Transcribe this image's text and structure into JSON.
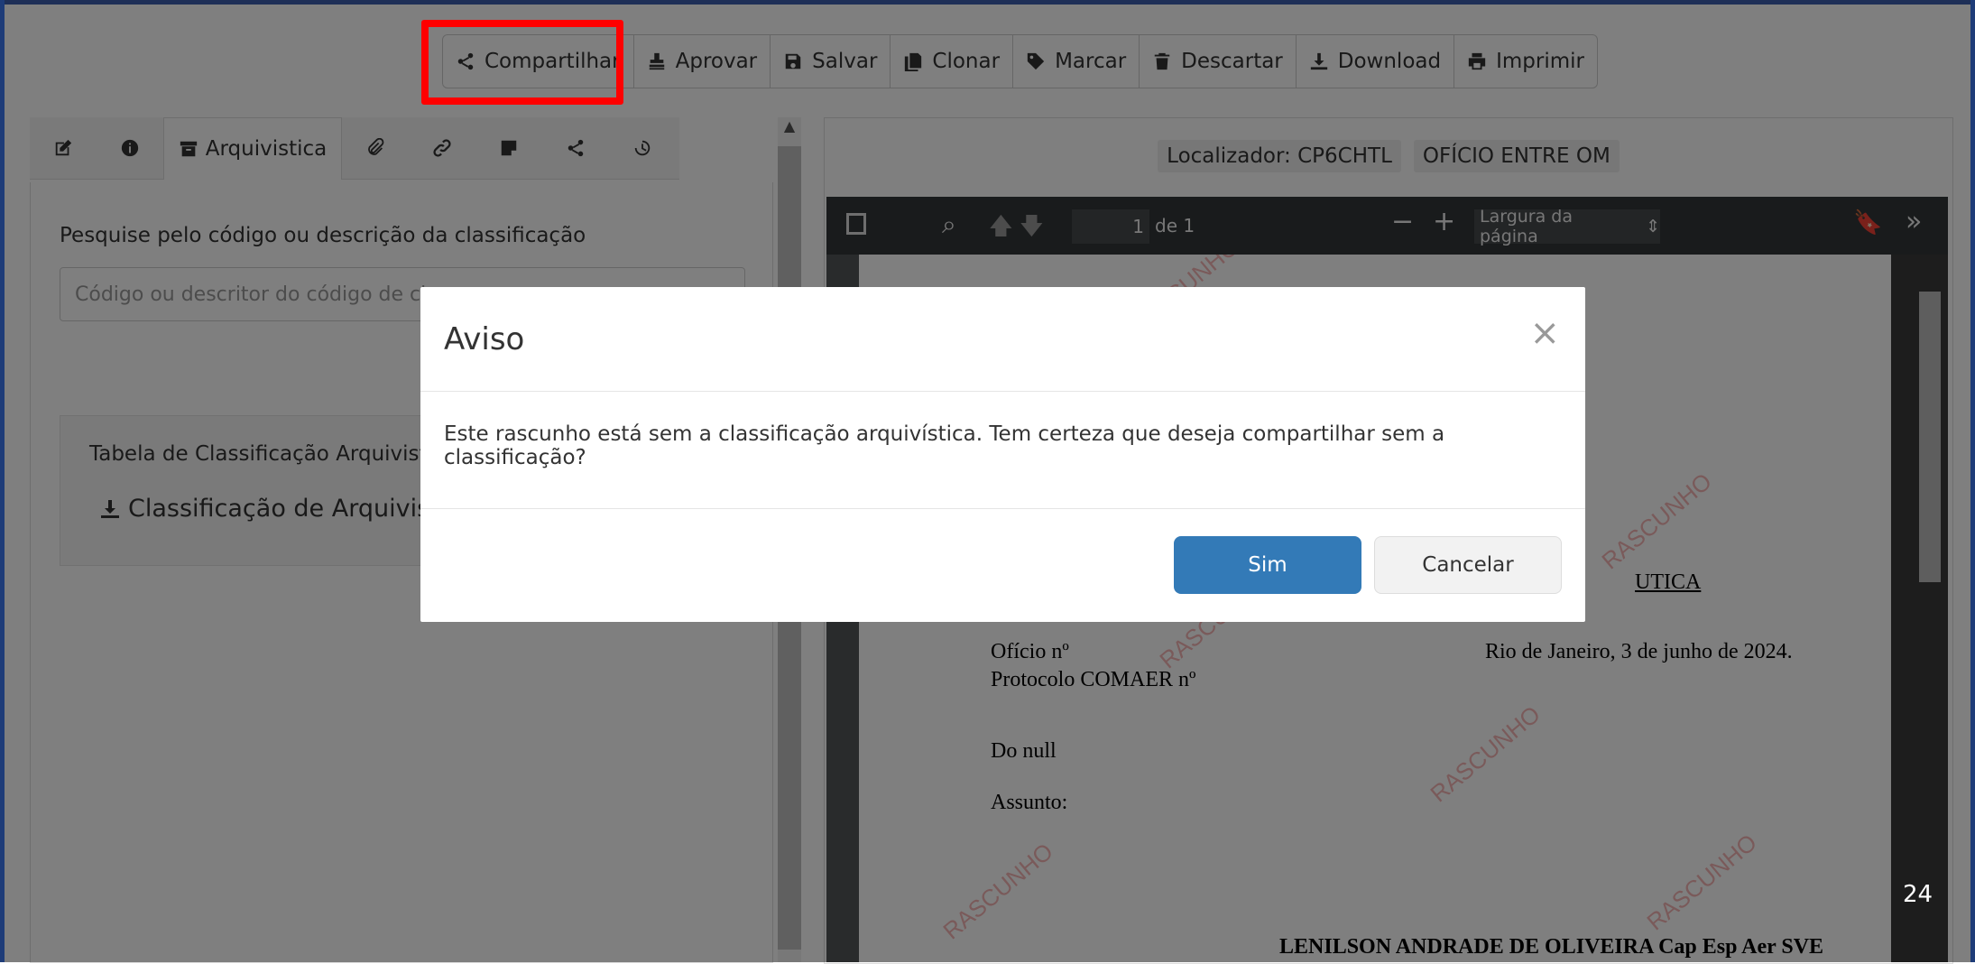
{
  "toolbar": {
    "buttons": [
      {
        "label": "Compartilhar",
        "icon": "share-icon"
      },
      {
        "label": "Aprovar",
        "icon": "stamp-icon"
      },
      {
        "label": "Salvar",
        "icon": "save-icon"
      },
      {
        "label": "Clonar",
        "icon": "copy-icon"
      },
      {
        "label": "Marcar",
        "icon": "tag-icon"
      },
      {
        "label": "Descartar",
        "icon": "trash-icon"
      },
      {
        "label": "Download",
        "icon": "download-icon"
      },
      {
        "label": "Imprimir",
        "icon": "print-icon"
      }
    ]
  },
  "left": {
    "active_tab": "Arquivistica",
    "search_label": "Pesquise pelo código ou descrição da classificação",
    "search_placeholder": "Código ou descritor do código de clas",
    "table_title": "Tabela de Classificação Arquivistic",
    "table_link": "Classificação de Arquivistica"
  },
  "right": {
    "locator_label": "Localizador: CP6CHTL",
    "doc_type": "OFÍCIO ENTRE OM",
    "pdf": {
      "page_value": "1",
      "page_of": "de 1",
      "zoom": "Largura da página"
    },
    "doc": {
      "heading_fragment": "UTICA",
      "oficio": "Ofício nº",
      "date": "Rio de Janeiro, 3 de junho de 2024.",
      "protocolo": "Protocolo COMAER nº",
      "do": "Do null",
      "assunto": "Assunto:",
      "signature": "LENILSON ANDRADE DE OLIVEIRA Cap Esp Aer SVE",
      "watermark": "RASCUNHO"
    }
  },
  "modal": {
    "title": "Aviso",
    "close": "×",
    "message": "Este rascunho está sem a classificação arquivística. Tem certeza que deseja compartilhar sem a classificação?",
    "confirm": "Sim",
    "cancel": "Cancelar"
  },
  "page_number": "24"
}
